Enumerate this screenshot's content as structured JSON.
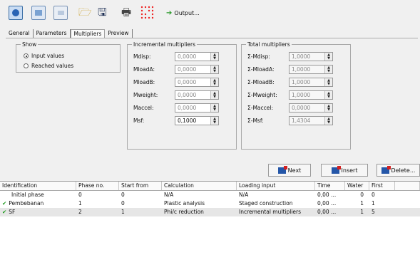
{
  "toolbar": {
    "output_label": "Output..."
  },
  "tabs": [
    {
      "label": "General"
    },
    {
      "label": "Parameters"
    },
    {
      "label": "Multipliers"
    },
    {
      "label": "Preview"
    }
  ],
  "show": {
    "legend": "Show",
    "options": [
      {
        "label": "Input values",
        "selected": true
      },
      {
        "label": "Reached values",
        "selected": false
      }
    ]
  },
  "incremental": {
    "legend": "Incremental multipliers",
    "rows": [
      {
        "label": "Mdisp:",
        "value": "0,0000"
      },
      {
        "label": "MloadA:",
        "value": "0,0000"
      },
      {
        "label": "MloadB:",
        "value": "0,0000"
      },
      {
        "label": "Mweight:",
        "value": "0,0000"
      },
      {
        "label": "Maccel:",
        "value": "0,0000"
      },
      {
        "label": "Msf:",
        "value": "0,1000"
      }
    ]
  },
  "total": {
    "legend": "Total multipliers",
    "rows": [
      {
        "label": "Σ-Mdisp:",
        "value": "1,0000"
      },
      {
        "label": "Σ-MloadA:",
        "value": "1,0000"
      },
      {
        "label": "Σ-MloadB:",
        "value": "1,0000"
      },
      {
        "label": "Σ-Mweight:",
        "value": "1,0000"
      },
      {
        "label": "Σ-Maccel:",
        "value": "0,0000"
      },
      {
        "label": "Σ-Msf:",
        "value": "1,4304"
      }
    ]
  },
  "actions": {
    "next": "Next",
    "insert": "Insert",
    "delete": "Delete..."
  },
  "table": {
    "headers": [
      "Identification",
      "Phase no.",
      "Start from",
      "Calculation",
      "Loading input",
      "Time",
      "Water",
      "First"
    ],
    "rows": [
      {
        "id": "Initial phase",
        "phase": "0",
        "start": "0",
        "calc": "N/A",
        "loading": "N/A",
        "time": "0,00 ...",
        "water": "0",
        "first": "0",
        "done": false
      },
      {
        "id": "Pembebanan",
        "phase": "1",
        "start": "0",
        "calc": "Plastic analysis",
        "loading": "Staged construction",
        "time": "0,00 ...",
        "water": "1",
        "first": "1",
        "done": true
      },
      {
        "id": "SF",
        "phase": "2",
        "start": "1",
        "calc": "Phi/c reduction",
        "loading": "Incremental multipliers",
        "time": "0,00 ...",
        "water": "1",
        "first": "5",
        "done": true
      }
    ]
  }
}
